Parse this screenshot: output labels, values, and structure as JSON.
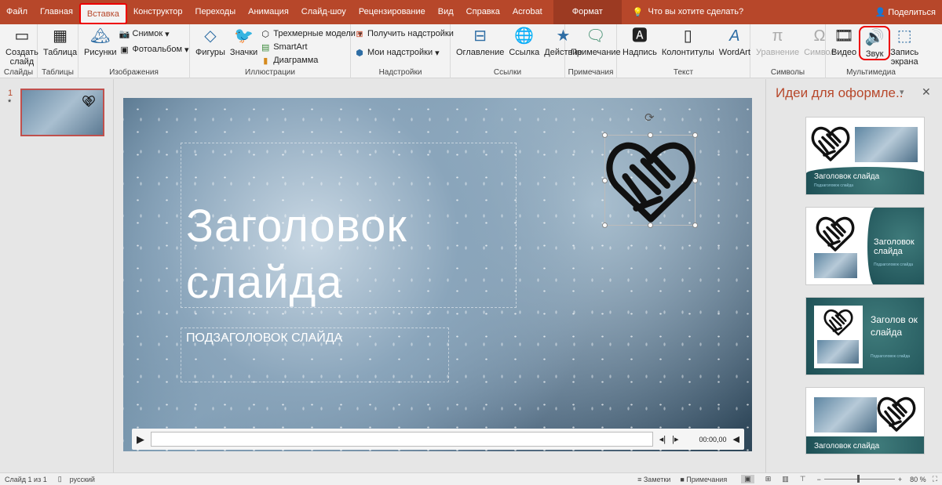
{
  "tabs": [
    "Файл",
    "Главная",
    "Вставка",
    "Конструктор",
    "Переходы",
    "Анимация",
    "Слайд-шоу",
    "Рецензирование",
    "Вид",
    "Справка",
    "Acrobat"
  ],
  "format_tab": "Формат",
  "tell_me": "Что вы хотите сделать?",
  "share": "Поделиться",
  "ribbon": {
    "slides": {
      "new_slide": "Создать слайд",
      "label": "Слайды"
    },
    "tables": {
      "table": "Таблица",
      "label": "Таблицы"
    },
    "images": {
      "pictures": "Рисунки",
      "screenshot": "Снимок",
      "album": "Фотоальбом",
      "label": "Изображения"
    },
    "illustrations": {
      "shapes": "Фигуры",
      "icons": "Значки",
      "models3d": "Трехмерные модели",
      "smartart": "SmartArt",
      "chart": "Диаграмма",
      "label": "Иллюстрации"
    },
    "addins": {
      "get": "Получить надстройки",
      "my": "Мои надстройки",
      "label": "Надстройки"
    },
    "links": {
      "zoom": "Оглавление",
      "link": "Ссылка",
      "action": "Действие",
      "label": "Ссылки"
    },
    "comments": {
      "comment": "Примечание",
      "label": "Примечания"
    },
    "text": {
      "textbox": "Надпись",
      "headerfooter": "Колонтитулы",
      "wordart": "WordArt",
      "label": "Текст"
    },
    "symbols": {
      "equation": "Уравнение",
      "symbol": "Символ",
      "label": "Символы"
    },
    "media": {
      "video": "Видео",
      "audio": "Звук",
      "record": "Запись экрана",
      "label": "Мультимедиа"
    }
  },
  "thumbnail": {
    "number": "1",
    "star": "*"
  },
  "slide": {
    "title_line1": "Заголовок",
    "title_line2": "слайда",
    "subtitle": "ПОДЗАГОЛОВОК СЛАЙДА"
  },
  "player": {
    "time": "00:00,00"
  },
  "designer": {
    "title": "Идеи для оформле..",
    "cards": [
      {
        "title": "Заголовок слайда",
        "sub": "Подзаголовок слайда"
      },
      {
        "title": "Заголовок слайда",
        "sub": "Подзаголовок слайда"
      },
      {
        "title": "Заголов ок слайда",
        "sub": "Подзаголовок слайда"
      },
      {
        "title": "Заголовок слайда"
      }
    ]
  },
  "status": {
    "slide": "Слайд 1 из 1",
    "lang": "русский",
    "notes": "Заметки",
    "comments": "Примечания",
    "zoom": "80 %"
  },
  "colors": {
    "accent": "#b7472a",
    "annotation": "#e00000"
  }
}
